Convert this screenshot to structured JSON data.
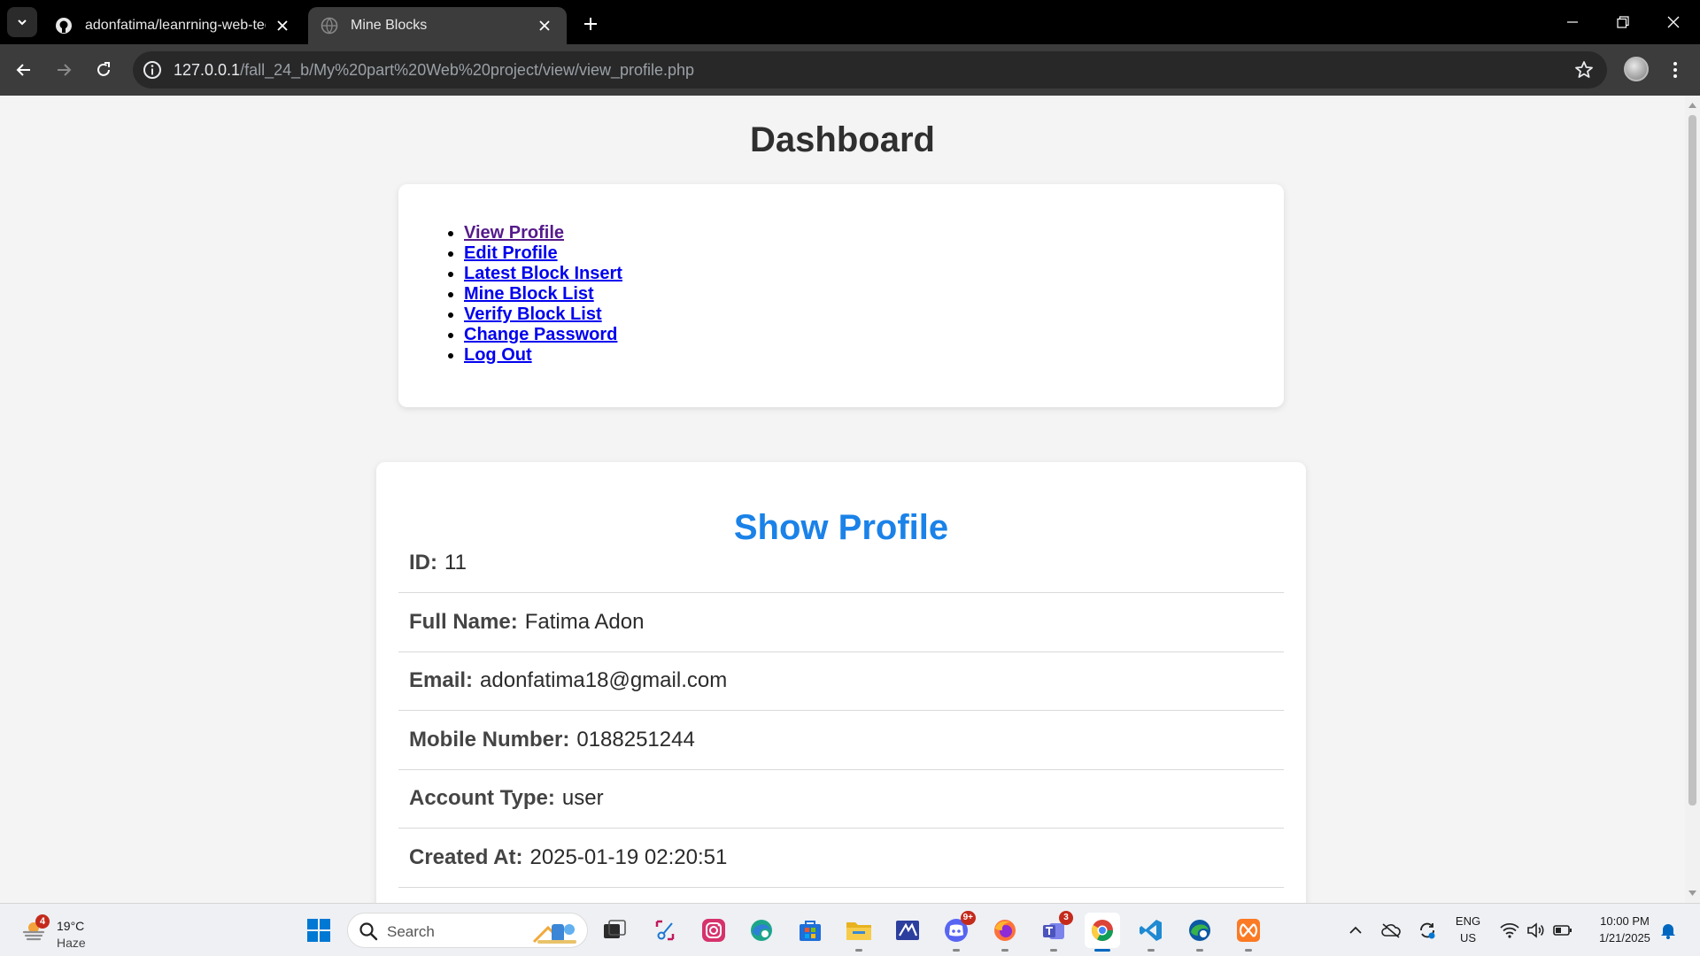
{
  "browser": {
    "tabs": [
      {
        "title": "adonfatima/leanrning-web-tech",
        "icon": "github-icon",
        "active": false
      },
      {
        "title": "Mine Blocks",
        "icon": "globe-icon",
        "active": true
      }
    ],
    "url_host": "127.0.0.1",
    "url_path": "/fall_24_b/My%20part%20Web%20project/view/view_profile.php"
  },
  "page": {
    "title": "Dashboard",
    "nav": [
      {
        "label": "View Profile",
        "visited": true
      },
      {
        "label": "Edit Profile",
        "visited": false
      },
      {
        "label": "Latest Block Insert",
        "visited": false
      },
      {
        "label": "Mine Block List",
        "visited": false
      },
      {
        "label": "Verify Block List",
        "visited": false
      },
      {
        "label": "Change Password",
        "visited": false
      },
      {
        "label": "Log Out",
        "visited": false
      }
    ],
    "profile": {
      "heading": "Show Profile",
      "fields": [
        {
          "label": "ID:",
          "value": "11"
        },
        {
          "label": "Full Name:",
          "value": "Fatima Adon"
        },
        {
          "label": "Email:",
          "value": "adonfatima18@gmail.com"
        },
        {
          "label": "Mobile Number:",
          "value": "0188251244"
        },
        {
          "label": "Account Type:",
          "value": "user"
        },
        {
          "label": "Created At:",
          "value": "2025-01-19 02:20:51"
        }
      ]
    }
  },
  "taskbar": {
    "weather": {
      "badge": "4",
      "temp": "19°C",
      "condition": "Haze"
    },
    "search_placeholder": "Search",
    "apps": [
      {
        "name": "start-menu-icon",
        "badge": ""
      },
      {
        "name": "task-view-icon",
        "badge": ""
      },
      {
        "name": "snipping-tool-icon",
        "badge": ""
      },
      {
        "name": "instagram-icon",
        "badge": ""
      },
      {
        "name": "edge-icon",
        "badge": ""
      },
      {
        "name": "microsoft-store-icon",
        "badge": ""
      },
      {
        "name": "file-explorer-icon",
        "badge": ""
      },
      {
        "name": "visual-studio-icon",
        "badge": ""
      },
      {
        "name": "discord-icon",
        "badge": "9+"
      },
      {
        "name": "firefox-icon",
        "badge": ""
      },
      {
        "name": "teams-icon",
        "badge": "3"
      },
      {
        "name": "chrome-icon",
        "badge": ""
      },
      {
        "name": "vscode-icon",
        "badge": ""
      },
      {
        "name": "edge-beta-icon",
        "badge": ""
      },
      {
        "name": "xampp-icon",
        "badge": ""
      }
    ],
    "lang_line1": "ENG",
    "lang_line2": "US",
    "time": "10:00 PM",
    "date": "1/21/2025"
  },
  "colors": {
    "accent_heading": "#1a82e8",
    "link": "#0000ee",
    "link_visited": "#551a8b"
  }
}
